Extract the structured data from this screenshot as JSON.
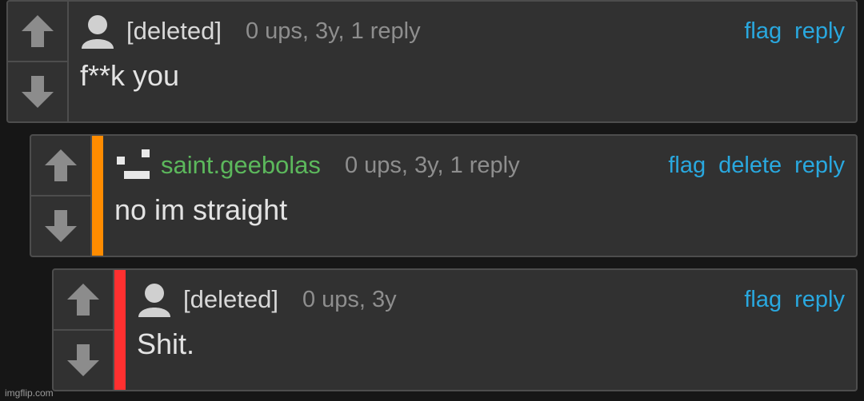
{
  "colors": {
    "background": "#161616",
    "card": "#313131",
    "border": "#4d4d4d",
    "link": "#29a8df",
    "mod_user": "#5cb85c",
    "depth_orange": "#ff8c00",
    "depth_red": "#ff3030"
  },
  "comments": [
    {
      "username": "[deleted]",
      "avatar_icon": "default-user-icon",
      "meta": "0 ups, 3y, 1 reply",
      "body": "f**k you",
      "actions": [
        "flag",
        "reply"
      ]
    },
    {
      "username": "saint.geebolas",
      "avatar_icon": "pixel-face-icon",
      "meta": "0 ups, 3y, 1 reply",
      "body": "no im straight",
      "actions": [
        "flag",
        "delete",
        "reply"
      ]
    },
    {
      "username": "[deleted]",
      "avatar_icon": "default-user-icon",
      "meta": "0 ups, 3y",
      "body": "Shit.",
      "actions": [
        "flag",
        "reply"
      ]
    }
  ],
  "watermark": "imgflip.com"
}
